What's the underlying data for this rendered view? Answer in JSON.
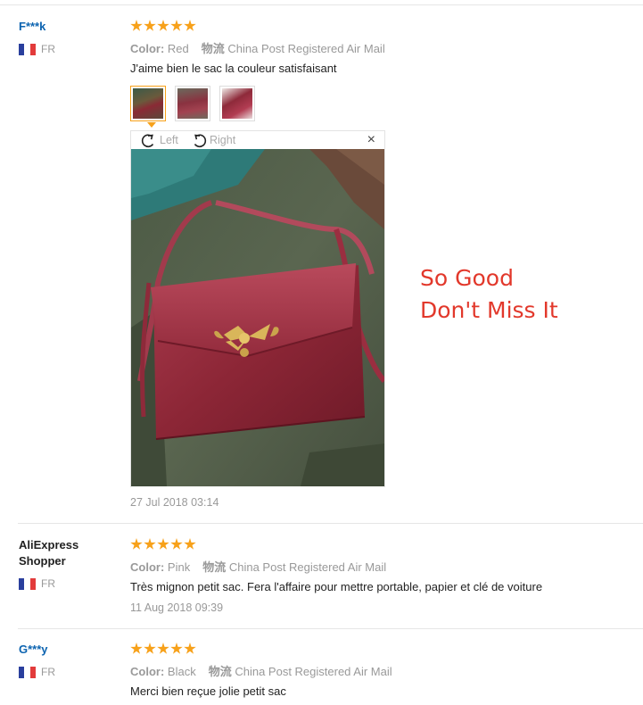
{
  "reviews": [
    {
      "user": "F***k",
      "country": "FR",
      "rating": 5,
      "color_label": "Color:",
      "color_value": "Red",
      "shipping_label": "物流",
      "shipping_value": "China Post Registered Air Mail",
      "text": "J'aime bien le sac la couleur satisfaisant",
      "viewer": {
        "rotate_left": "Left",
        "rotate_right": "Right",
        "close": "×"
      },
      "date": "27 Jul 2018 03:14"
    },
    {
      "user": "AliExpress Shopper",
      "country": "FR",
      "rating": 5,
      "color_label": "Color:",
      "color_value": "Pink",
      "shipping_label": "物流",
      "shipping_value": "China Post Registered Air Mail",
      "text": "Très mignon petit sac. Fera l'affaire pour mettre portable, papier et clé de voiture",
      "date": "11 Aug 2018 09:39"
    },
    {
      "user": "G***y",
      "country": "FR",
      "rating": 5,
      "color_label": "Color:",
      "color_value": "Black",
      "shipping_label": "物流",
      "shipping_value": "China Post Registered Air Mail",
      "text": "Merci bien reçue jolie petit sac"
    }
  ],
  "promo": {
    "line1": "So Good",
    "line2": "Don't Miss It"
  },
  "colors": {
    "star": "#f7a11a",
    "user_link": "#0b63b0",
    "promo": "#e2382b"
  }
}
